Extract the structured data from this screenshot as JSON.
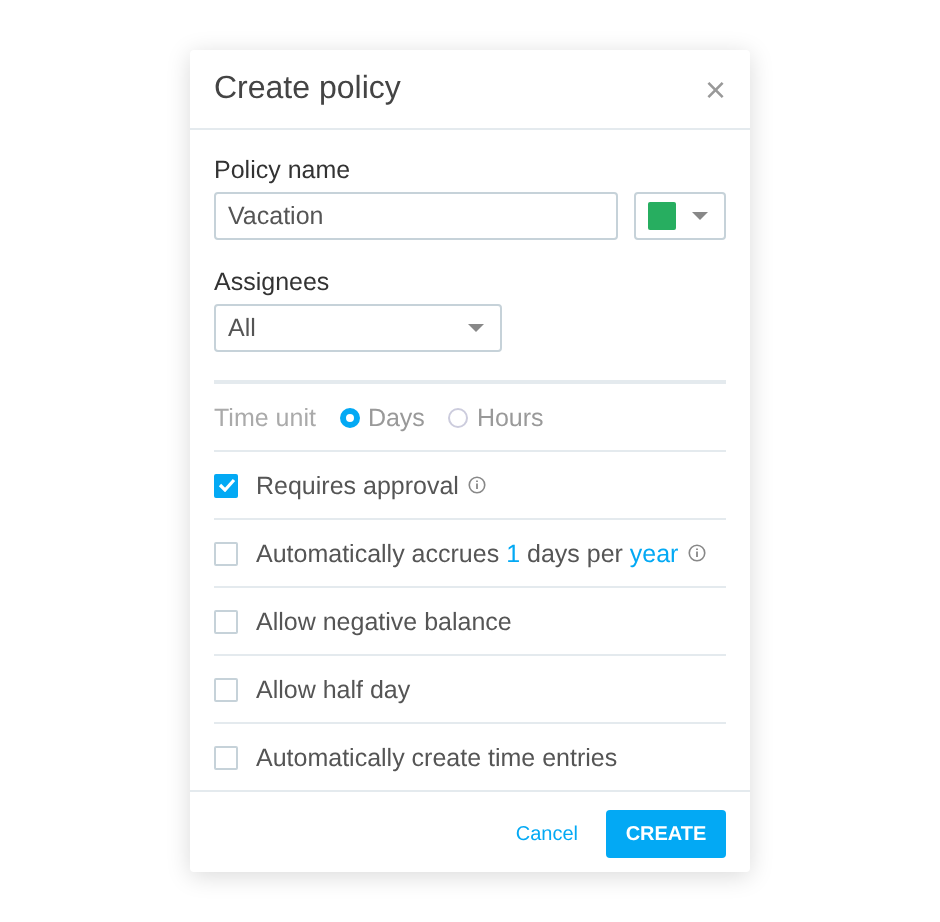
{
  "dialog": {
    "title": "Create policy",
    "close": "×"
  },
  "policy_name": {
    "label": "Policy name",
    "value": "Vacation",
    "color": "#27ae60"
  },
  "assignees": {
    "label": "Assignees",
    "value": "All"
  },
  "time_unit": {
    "label": "Time unit",
    "options": [
      {
        "label": "Days",
        "selected": true
      },
      {
        "label": "Hours",
        "selected": false
      }
    ]
  },
  "options": [
    {
      "kind": "plain",
      "label": "Requires approval",
      "checked": true,
      "info": true
    },
    {
      "kind": "accrual",
      "before": "Automatically accrues",
      "amount": "1",
      "middle": "days per",
      "period": "year",
      "checked": false,
      "info": true
    },
    {
      "kind": "plain",
      "label": "Allow negative balance",
      "checked": false,
      "info": false
    },
    {
      "kind": "plain",
      "label": "Allow half day",
      "checked": false,
      "info": false
    },
    {
      "kind": "plain",
      "label": "Automatically create time entries",
      "checked": false,
      "info": false
    }
  ],
  "buttons": {
    "cancel": "Cancel",
    "create": "CREATE"
  }
}
